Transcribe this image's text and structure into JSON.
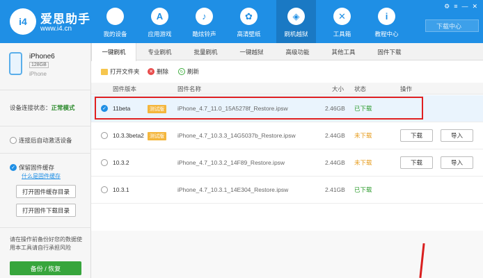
{
  "header": {
    "brand_name": "爱思助手",
    "brand_url": "www.i4.cn",
    "logo_text": "i4",
    "nav": [
      {
        "label": "我的设备",
        "icon": "apple-icon"
      },
      {
        "label": "应用游戏",
        "icon": "app-store-icon"
      },
      {
        "label": "酷炫铃声",
        "icon": "bell-icon"
      },
      {
        "label": "高清壁纸",
        "icon": "flower-icon"
      },
      {
        "label": "刷机越狱",
        "icon": "dropbox-icon"
      },
      {
        "label": "工具箱",
        "icon": "tools-icon"
      },
      {
        "label": "教程中心",
        "icon": "info-icon"
      }
    ],
    "active_nav": 4,
    "download_center": "下载中心"
  },
  "sidebar": {
    "device_name": "iPhone6",
    "storage": "128GB",
    "device_type": "iPhone",
    "conn_label": "设备连接状态：",
    "conn_status": "正常模式",
    "auto_activate": "连接后自动激活设备",
    "keep_cache": "保留固件缓存",
    "cache_link": "什么是固件缓存",
    "open_cache_dir": "打开固件缓存目录",
    "open_download_dir": "打开固件下载目录",
    "warning": "请在操作前备份好您的数据使用本工具请自行承担风险",
    "backup_button": "备份 / 恢复"
  },
  "tabs": [
    "一键刷机",
    "专业刷机",
    "批量刷机",
    "一键越狱",
    "高级功能",
    "其他工具",
    "固件下载"
  ],
  "toolbar": {
    "open_folder": "打开文件夹",
    "delete": "删除",
    "refresh": "刷新"
  },
  "table": {
    "headers": {
      "version": "固件版本",
      "name": "固件名称",
      "size": "大小",
      "status": "状态",
      "action": "操作"
    },
    "rows": [
      {
        "version": "11beta",
        "badge": "测试版",
        "name": "iPhone_4.7_11.0_15A5278f_Restore.ipsw",
        "size": "2.46GB",
        "status": "已下载",
        "selected": true
      },
      {
        "version": "10.3.3beta2",
        "badge": "测试版",
        "name": "iPhone_4.7_10.3.3_14G5037b_Restore.ipsw",
        "size": "2.44GB",
        "status": "未下载",
        "selected": false,
        "btn_download": "下载",
        "btn_import": "导入"
      },
      {
        "version": "10.3.2",
        "name": "iPhone_4.7_10.3.2_14F89_Restore.ipsw",
        "size": "2.44GB",
        "status": "未下载",
        "selected": false,
        "btn_download": "下载",
        "btn_import": "导入"
      },
      {
        "version": "10.3.1",
        "name": "iPhone_4.7_10.3.1_14E304_Restore.ipsw",
        "size": "2.41GB",
        "status": "已下载",
        "selected": false
      }
    ]
  },
  "colors": {
    "header_blue": "#1f8fe5",
    "active_nav": "#1a79c4",
    "success_green": "#2c9b2c",
    "pending_orange": "#e69a18",
    "highlight_red": "#e02020"
  }
}
